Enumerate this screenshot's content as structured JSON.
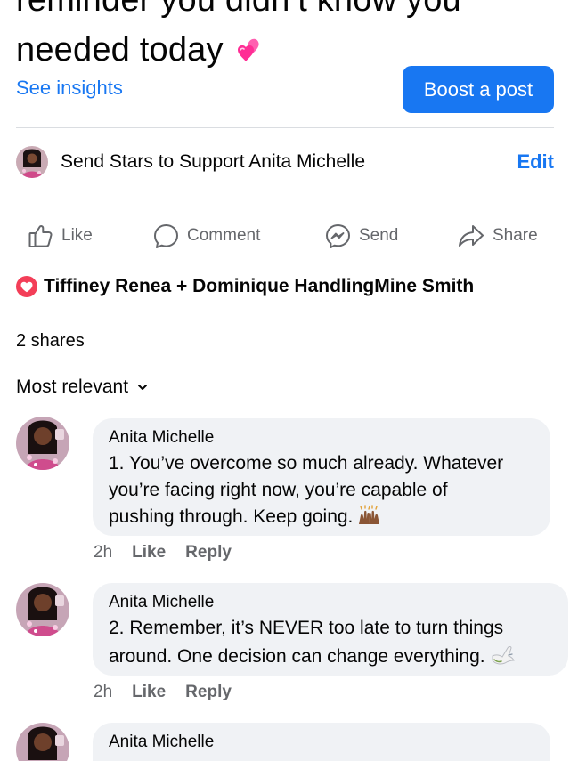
{
  "post": {
    "title_line1": "reminder you didn’t know you",
    "title_line2": "needed today",
    "heart_emoji_icon": "two-hearts-icon"
  },
  "insights": {
    "label": "See insights"
  },
  "boost": {
    "label": "Boost a post"
  },
  "stars": {
    "text": "Send Stars to Support Anita Michelle",
    "edit_label": "Edit"
  },
  "actions": {
    "like": {
      "label": "Like",
      "icon": "thumbs-up-icon"
    },
    "comment": {
      "label": "Comment",
      "icon": "comment-icon"
    },
    "send": {
      "label": "Send",
      "icon": "messenger-icon"
    },
    "share": {
      "label": "Share",
      "icon": "share-arrow-icon"
    }
  },
  "reactions": {
    "names": "Tiffiney Renea + Dominique HandlingMine Smith",
    "icon": "love-reaction-icon"
  },
  "shares": {
    "text": "2 shares"
  },
  "sort": {
    "label": "Most relevant"
  },
  "comments": [
    {
      "name": "Anita Michelle",
      "line1": "1. You’ve overcome so much already. Whatever",
      "line2": "you’re facing right now, you’re capable of",
      "line3": "pushing through. Keep going.",
      "emoji": "raising-hands-icon",
      "time": "2h",
      "like": "Like",
      "reply": "Reply"
    },
    {
      "name": "Anita Michelle",
      "line1": "2. Remember, it’s NEVER too late to turn things",
      "line2": "around. One decision can change everything.",
      "emoji": "dove-icon",
      "time": "2h",
      "like": "Like",
      "reply": "Reply"
    },
    {
      "name": "Anita Michelle"
    }
  ],
  "colors": {
    "accent": "#1877f2",
    "muted": "#65676b",
    "bubble": "#f0f2f5",
    "love": "#f33e58"
  }
}
